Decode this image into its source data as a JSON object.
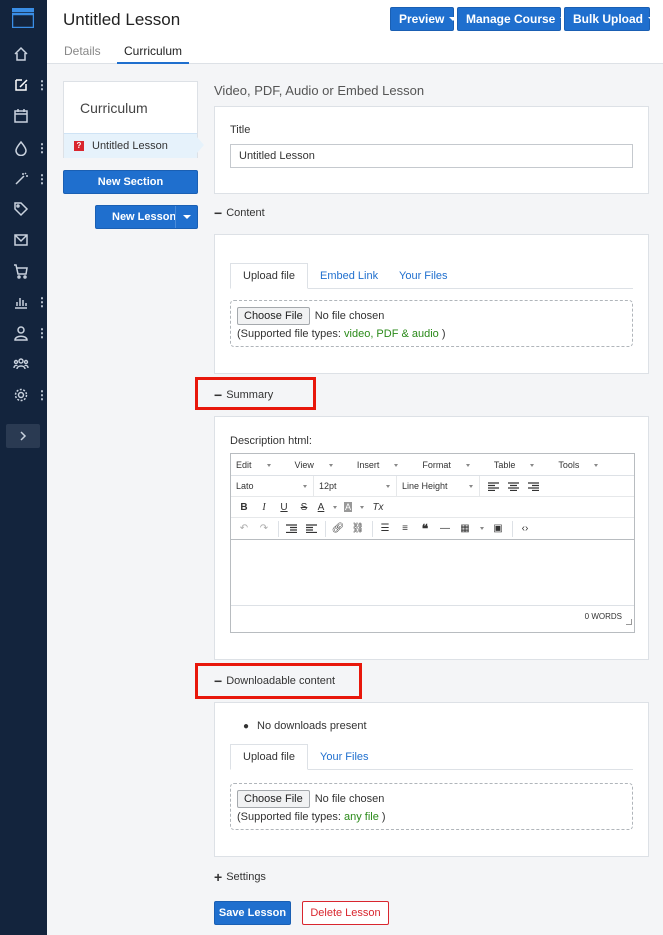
{
  "header": {
    "title": "Untitled Lesson",
    "buttons": {
      "preview": "Preview",
      "manage_course": "Manage Course",
      "bulk_upload": "Bulk Upload"
    },
    "tabs": {
      "details": "Details",
      "curriculum": "Curriculum"
    }
  },
  "sidebar": {
    "title": "Curriculum",
    "lesson_item": "Untitled Lesson",
    "lesson_item_icon": "?",
    "new_section": "New Section",
    "new_lesson": "New Lesson"
  },
  "main": {
    "lesson_type_heading": "Video, PDF, Audio or Embed Lesson",
    "title_label": "Title",
    "title_value": "Untitled Lesson",
    "content": {
      "heading": "Content",
      "tabs": [
        "Upload file",
        "Embed Link",
        "Your Files"
      ],
      "choose_file": "Choose File",
      "no_file": "No file chosen",
      "supported_prefix": "(Supported file types: ",
      "supported_types": "video, PDF & audio",
      "supported_suffix": " )"
    },
    "summary": {
      "heading": "Summary",
      "description_label": "Description html:",
      "menu": [
        "Edit",
        "View",
        "Insert",
        "Format",
        "Table",
        "Tools"
      ],
      "font_family": "Lato",
      "font_size": "12pt",
      "line_height": "Line Height",
      "word_count": "0 WORDS"
    },
    "downloadable": {
      "heading": "Downloadable content",
      "no_downloads": "No downloads present",
      "tabs": [
        "Upload file",
        "Your Files"
      ],
      "choose_file": "Choose File",
      "no_file": "No file chosen",
      "supported_prefix": "(Supported file types: ",
      "supported_types": "any file",
      "supported_suffix": " )"
    },
    "settings": {
      "heading": "Settings"
    },
    "actions": {
      "save": "Save Lesson",
      "delete": "Delete Lesson"
    }
  },
  "colors": {
    "nav_bg": "#13243d",
    "primary": "#1f6fce",
    "danger": "#d9262e",
    "highlight_outline": "#e8170b",
    "success_text": "#2a8a19"
  }
}
